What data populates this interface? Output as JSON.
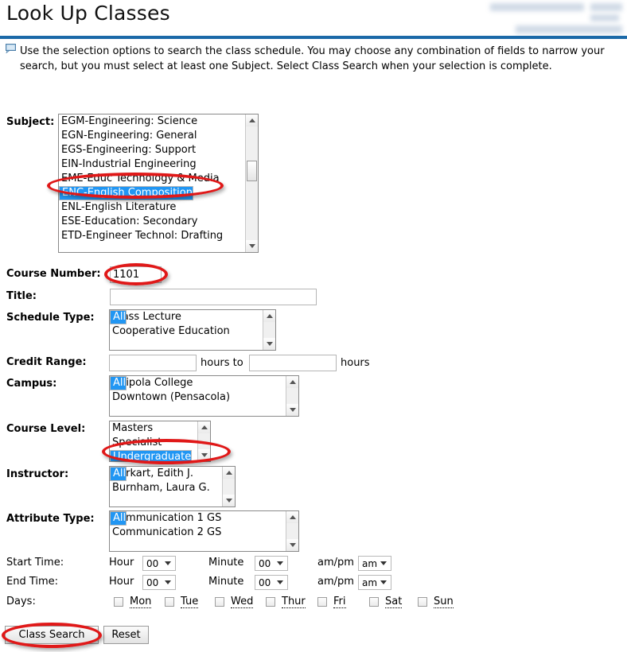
{
  "page": {
    "title": "Look Up Classes",
    "redacted_header_note": "blurred account/date text",
    "instructions_line1": "Use the selection options to search the class schedule. You may choose any combination of fields to narrow your",
    "instructions_line2": "search, but you must select at least one Subject. Select Class Search when your selection is complete.",
    "info_icon": "info-bubble-icon",
    "accent_color": "#1b69a8",
    "selection_color": "#2196f3",
    "annotation_color": "#e01818"
  },
  "labels": {
    "subject": "Subject:",
    "course_number": "Course Number:",
    "title": "Title:",
    "schedule_type": "Schedule Type:",
    "credit_range": "Credit Range:",
    "campus": "Campus:",
    "course_level": "Course Level:",
    "instructor": "Instructor:",
    "attribute_type": "Attribute Type:",
    "start_time": "Start Time:",
    "end_time": "End Time:",
    "days": "Days:",
    "hours_to": "hours to",
    "hours": "hours",
    "hour": "Hour",
    "minute": "Minute",
    "ampm": "am/pm"
  },
  "subject": {
    "options": [
      "EGM-Engineering: Science",
      "EGN-Engineering: General",
      "EGS-Engineering: Support",
      "EIN-Industrial Engineering",
      "EME-Educ Technology & Media",
      "ENC-English Composition",
      "ENG-English: General",
      "ENL-English Literature",
      "ESE-Education: Secondary",
      "ETD-Engineer Technol: Drafting"
    ],
    "selected": "ENC-English Composition",
    "selected_index": 5
  },
  "course_number": {
    "value": "1101"
  },
  "title_field": {
    "value": ""
  },
  "schedule_type": {
    "options": [
      "All",
      "Class Lecture",
      "Cooperative Education"
    ],
    "selected": "All",
    "selected_index": 0
  },
  "credit_range": {
    "from": "",
    "to": ""
  },
  "campus": {
    "options": [
      "All",
      "Chipola College",
      "Downtown (Pensacola)"
    ],
    "selected": "All",
    "selected_index": 0
  },
  "course_level": {
    "options": [
      "Masters",
      "Specialist",
      "Undergraduate"
    ],
    "selected": "Undergraduate",
    "selected_index": 2
  },
  "instructor": {
    "options": [
      "All",
      "Burkart, Edith J.",
      "Burnham, Laura G."
    ],
    "selected": "All",
    "selected_index": 0
  },
  "attribute_type": {
    "options": [
      "All",
      "Communication 1 GS",
      "Communication 2 GS"
    ],
    "selected": "All",
    "selected_index": 0
  },
  "start_time": {
    "hour": "00",
    "minute": "00",
    "ampm": "am"
  },
  "end_time": {
    "hour": "00",
    "minute": "00",
    "ampm": "am"
  },
  "days": [
    {
      "label": "Mon",
      "checked": false
    },
    {
      "label": "Tue",
      "checked": false
    },
    {
      "label": "Wed",
      "checked": false
    },
    {
      "label": "Thur",
      "checked": false
    },
    {
      "label": "Fri",
      "checked": false
    },
    {
      "label": "Sat",
      "checked": false
    },
    {
      "label": "Sun",
      "checked": false
    }
  ],
  "buttons": {
    "class_search": "Class Search",
    "reset": "Reset"
  }
}
